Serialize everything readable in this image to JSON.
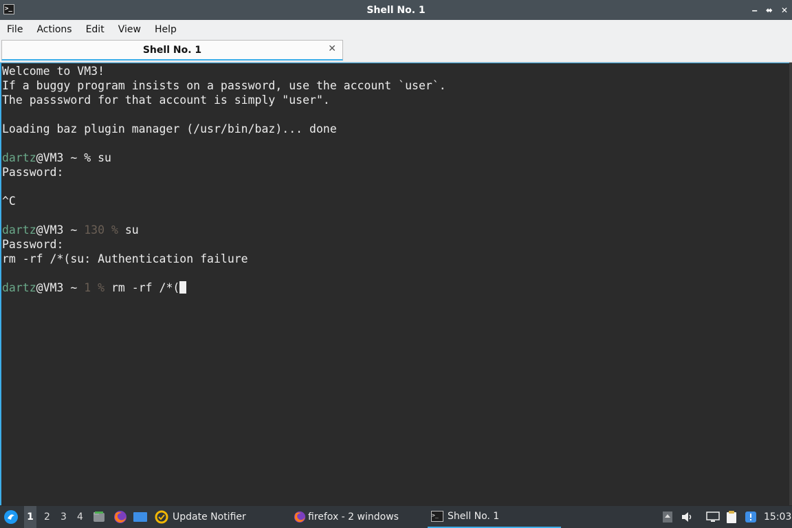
{
  "window": {
    "title": "Shell No. 1",
    "controls": {
      "minimize": "‒",
      "restore": "⬌",
      "close": "✕"
    }
  },
  "menu": {
    "items": [
      "File",
      "Actions",
      "Edit",
      "View",
      "Help"
    ]
  },
  "tabs": [
    {
      "label": "Shell No. 1",
      "close": "✕"
    }
  ],
  "terminal": {
    "lines": {
      "l1": "Welcome to VM3!",
      "l2": "If a buggy program insists on a password, use the account `user`.",
      "l3": "The passsword for that account is simply \"user\".",
      "l4": "Loading baz plugin manager (/usr/bin/baz)... done",
      "p1_user": "dartz",
      "p1_rest": "@VM3 ~ % su",
      "l6": "Password:",
      "l7": "^C",
      "p2_user": "dartz",
      "p2_host": "@VM3 ~ ",
      "p2_code": "130 % ",
      "p2_cmd": "su",
      "l9": "Password:",
      "l10": "rm -rf /*(su: Authentication failure",
      "p3_user": "dartz",
      "p3_host": "@VM3 ~ ",
      "p3_code": "1 % ",
      "p3_cmd": "rm -rf /*("
    },
    "colors": {
      "background": "#2b2b2b",
      "prompt_user": "#6aa889",
      "exit_code": "#6a5f55"
    }
  },
  "taskbar": {
    "desktops": [
      "1",
      "2",
      "3",
      "4"
    ],
    "active_desktop": "1",
    "tasks": [
      {
        "label": "Update Notifier"
      },
      {
        "label": "firefox - 2 windows"
      },
      {
        "label": "Shell No. 1"
      }
    ],
    "clock": "15:03"
  }
}
